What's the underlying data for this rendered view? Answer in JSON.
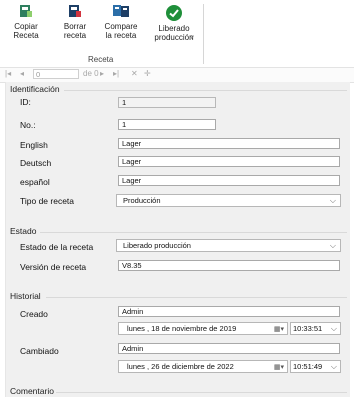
{
  "ribbon": {
    "buttons": [
      {
        "label": "Copiar\nReceta"
      },
      {
        "label": "Borrar\nreceta"
      },
      {
        "label": "Compare\nla receta"
      },
      {
        "label": "Liberado\nproducción"
      }
    ],
    "dropdown_arrow": "˅",
    "group_label": "Receta"
  },
  "navbar": {
    "first": "|◂",
    "prev": "◂",
    "position": "0",
    "of": "de 0",
    "next": "▸",
    "last": "▸|",
    "delete": "✕",
    "add": "✛"
  },
  "identificacion": {
    "title": "Identificación",
    "id_label": "ID:",
    "id_value": "1",
    "no_label": "No.:",
    "no_value": "1",
    "english_label": "English",
    "english_value": "Lager",
    "deutsch_label": "Deutsch",
    "deutsch_value": "Lager",
    "espanol_label": "español",
    "espanol_value": "Lager",
    "tipo_label": "Tipo de receta",
    "tipo_value": "Producción"
  },
  "estado": {
    "title": "Estado",
    "estado_label": "Estado de la receta",
    "estado_value": "Liberado producción",
    "version_label": "Versión de receta",
    "version_value": "V8.35"
  },
  "historial": {
    "title": "Historial",
    "creado_label": "Creado",
    "creado_user": "Admin",
    "creado_date": "lunes    , 18 de noviembre de 2019",
    "creado_time": "10:33:51",
    "cambiado_label": "Cambiado",
    "cambiado_user": "Admin",
    "cambiado_date": "lunes    , 26 de  diciembre  de 2022",
    "cambiado_time": "10:51:49"
  },
  "comentario": {
    "title": "Comentario"
  },
  "colors": {
    "copy_icon": "#2f7f5f",
    "delete_icon": "#b8323a",
    "compare_icon": "#2b6ea8",
    "release_icon": "#1f8f3a"
  }
}
